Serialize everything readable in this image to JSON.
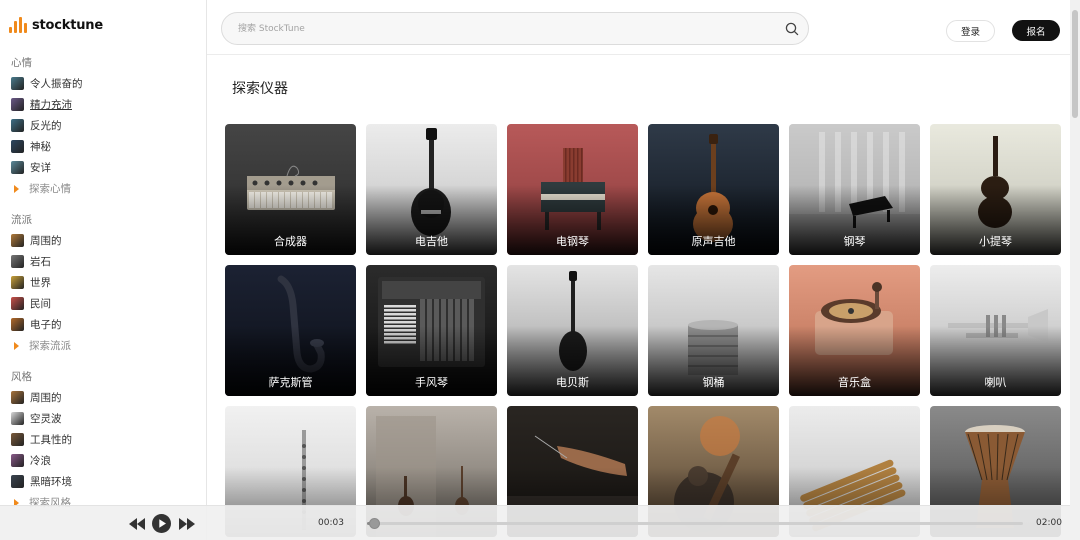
{
  "brand": {
    "name": "stocktune",
    "accent": "#f08a1c"
  },
  "header": {
    "search_placeholder": "搜索 StockTune",
    "login_label": "登录",
    "signup_label": "报名"
  },
  "sidebar": {
    "moods": {
      "title": "心情",
      "items": [
        {
          "label": "令人振奋的",
          "color": "#4a7b8c"
        },
        {
          "label": "精力充沛",
          "color": "#6b5a88"
        },
        {
          "label": "反光的",
          "color": "#3e6f86"
        },
        {
          "label": "神秘",
          "color": "#2c4660"
        },
        {
          "label": "安详",
          "color": "#5c8a9a"
        }
      ],
      "explore_label": "探索心情"
    },
    "genres": {
      "title": "流派",
      "items": [
        {
          "label": "周围的",
          "color": "#b07a3a"
        },
        {
          "label": "岩石",
          "color": "#777777"
        },
        {
          "label": "世界",
          "color": "#c9a13a"
        },
        {
          "label": "民间",
          "color": "#c9504a"
        },
        {
          "label": "电子的",
          "color": "#b36a2a"
        }
      ],
      "explore_label": "探索流派"
    },
    "styles": {
      "title": "风格",
      "items": [
        {
          "label": "周围的",
          "color": "#a8743c"
        },
        {
          "label": "空灵波",
          "color": "#d8d8d8"
        },
        {
          "label": "工具性的",
          "color": "#7a5a3a"
        },
        {
          "label": "冷浪",
          "color": "#8a5a8a"
        },
        {
          "label": "黑暗环境",
          "color": "#3a4450"
        }
      ],
      "explore_label": "探索风格"
    }
  },
  "main": {
    "title": "探索仪器",
    "cards": [
      {
        "label": "合成器",
        "bg_top": "#454545",
        "bg_bottom": "#2a2a2a",
        "art": "synth"
      },
      {
        "label": "电吉他",
        "bg_top": "#ececec",
        "bg_bottom": "#bdbdbd",
        "art": "guitar"
      },
      {
        "label": "电钢琴",
        "bg_top": "#b85a5a",
        "bg_bottom": "#6e2a2a",
        "art": "epiano"
      },
      {
        "label": "原声吉他",
        "bg_top": "#2f3a48",
        "bg_bottom": "#0e141c",
        "art": "acoustic"
      },
      {
        "label": "钢琴",
        "bg_top": "#d0d0d0",
        "bg_bottom": "#8c8c8c",
        "art": "piano"
      },
      {
        "label": "小提琴",
        "bg_top": "#e9e9de",
        "bg_bottom": "#bfbfb3",
        "art": "violin"
      },
      {
        "label": "萨克斯管",
        "bg_top": "#1c2233",
        "bg_bottom": "#0b0e16",
        "art": "sax"
      },
      {
        "label": "手风琴",
        "bg_top": "#2b2b2b",
        "bg_bottom": "#111111",
        "art": "accordion"
      },
      {
        "label": "电贝斯",
        "bg_top": "#e4e4e4",
        "bg_bottom": "#9a9a9a",
        "art": "bass"
      },
      {
        "label": "钢桶",
        "bg_top": "#e6e6e6",
        "bg_bottom": "#a9a9a9",
        "art": "drum"
      },
      {
        "label": "音乐盒",
        "bg_top": "#e39c82",
        "bg_bottom": "#b46a50",
        "art": "musicbox"
      },
      {
        "label": "喇叭",
        "bg_top": "#ededed",
        "bg_bottom": "#b0b0b0",
        "art": "trumpet"
      },
      {
        "label": "",
        "bg_top": "#f1f1f1",
        "bg_bottom": "#cfcfcf",
        "art": "flute"
      },
      {
        "label": "",
        "bg_top": "#b9b2aa",
        "bg_bottom": "#6e6860",
        "art": "room"
      },
      {
        "label": "",
        "bg_top": "#2a2622",
        "bg_bottom": "#15120f",
        "art": "hand"
      },
      {
        "label": "",
        "bg_top": "#a28a6a",
        "bg_bottom": "#4a3a2a",
        "art": "warrior"
      },
      {
        "label": "",
        "bg_top": "#ececec",
        "bg_bottom": "#bfbfbf",
        "art": "pipes"
      },
      {
        "label": "",
        "bg_top": "#8a8a8a",
        "bg_bottom": "#4a4a4a",
        "art": "djembe"
      }
    ]
  },
  "player": {
    "current_time": "00:03",
    "total_time": "02:00",
    "progress": 0.01
  }
}
